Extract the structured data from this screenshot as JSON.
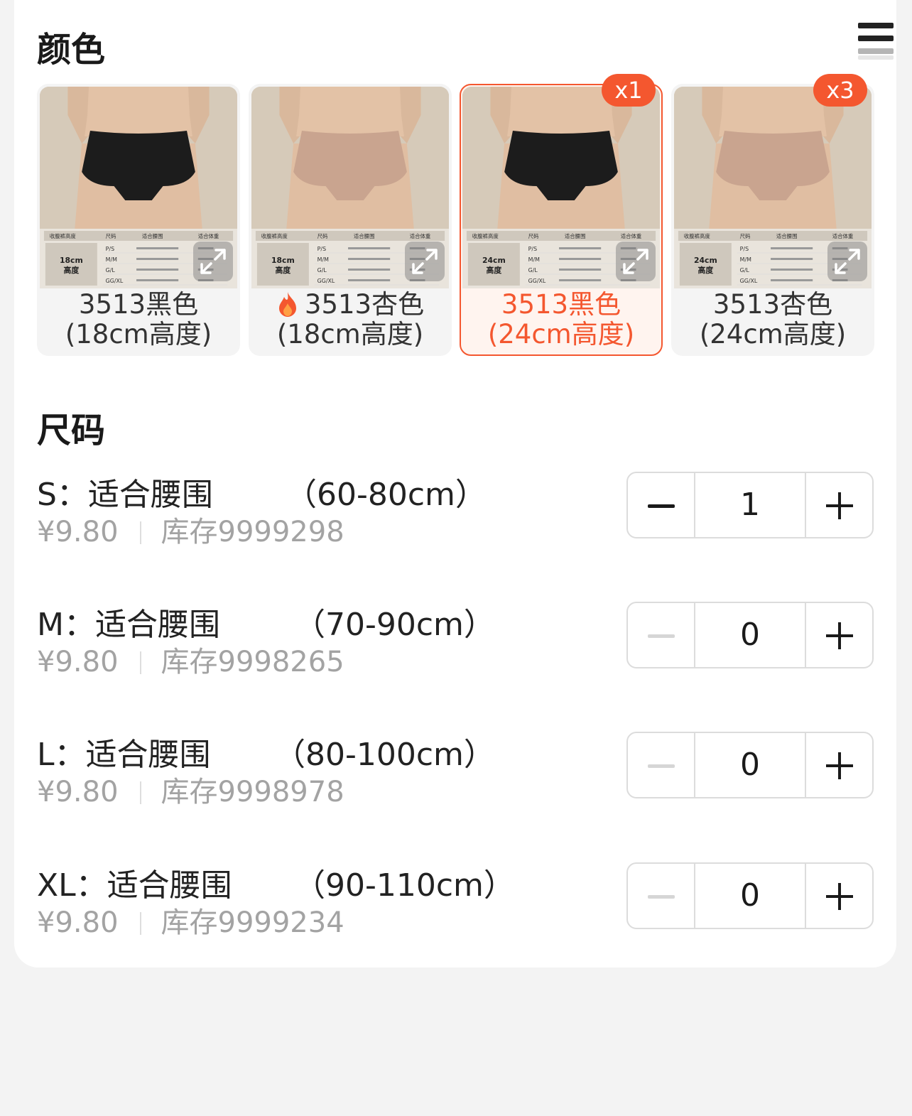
{
  "color_section": {
    "title": "颜色",
    "options": [
      {
        "line1": "3513黑色",
        "line2": "(18cm高度)",
        "product_color": "#1c1c1c",
        "selected": false,
        "badge": "",
        "hot": false,
        "chart_height_label": "18cm\n高度"
      },
      {
        "line1": "3513杏色",
        "line2": "(18cm高度)",
        "product_color": "#c9a48f",
        "selected": false,
        "badge": "",
        "hot": true,
        "chart_height_label": "18cm\n高度"
      },
      {
        "line1": "3513黑色",
        "line2": "(24cm高度)",
        "product_color": "#1c1c1c",
        "selected": true,
        "badge": "x1",
        "hot": false,
        "chart_height_label": "24cm\n高度"
      },
      {
        "line1": "3513杏色",
        "line2": "(24cm高度)",
        "product_color": "#c9a48f",
        "selected": false,
        "badge": "x3",
        "hot": false,
        "chart_height_label": "24cm\n高度"
      }
    ],
    "size_chart_headers": [
      "收腹裤高度",
      "尺码",
      "适合腰围",
      "适合体重"
    ],
    "size_chart_sizes": [
      "P/S",
      "M/M",
      "G/L",
      "GG/XL"
    ]
  },
  "size_section": {
    "title": "尺码",
    "rows": [
      {
        "name": "S：适合腰围",
        "range": "（60-80cm）",
        "price": "¥9.80",
        "stock": "库存9999298",
        "qty": "1",
        "minus_enabled": true
      },
      {
        "name": "M：适合腰围",
        "range": "（70-90cm）",
        "price": "¥9.80",
        "stock": "库存9998265",
        "qty": "0",
        "minus_enabled": false
      },
      {
        "name": "L：适合腰围",
        "range": "（80-100cm）",
        "price": "¥9.80",
        "stock": "库存9998978",
        "qty": "0",
        "minus_enabled": false
      },
      {
        "name": "XL：适合腰围",
        "range": "（90-110cm）",
        "price": "¥9.80",
        "stock": "库存9999234",
        "qty": "0",
        "minus_enabled": false
      }
    ]
  },
  "colors": {
    "accent": "#f4572f",
    "muted": "#a3a3a3"
  }
}
